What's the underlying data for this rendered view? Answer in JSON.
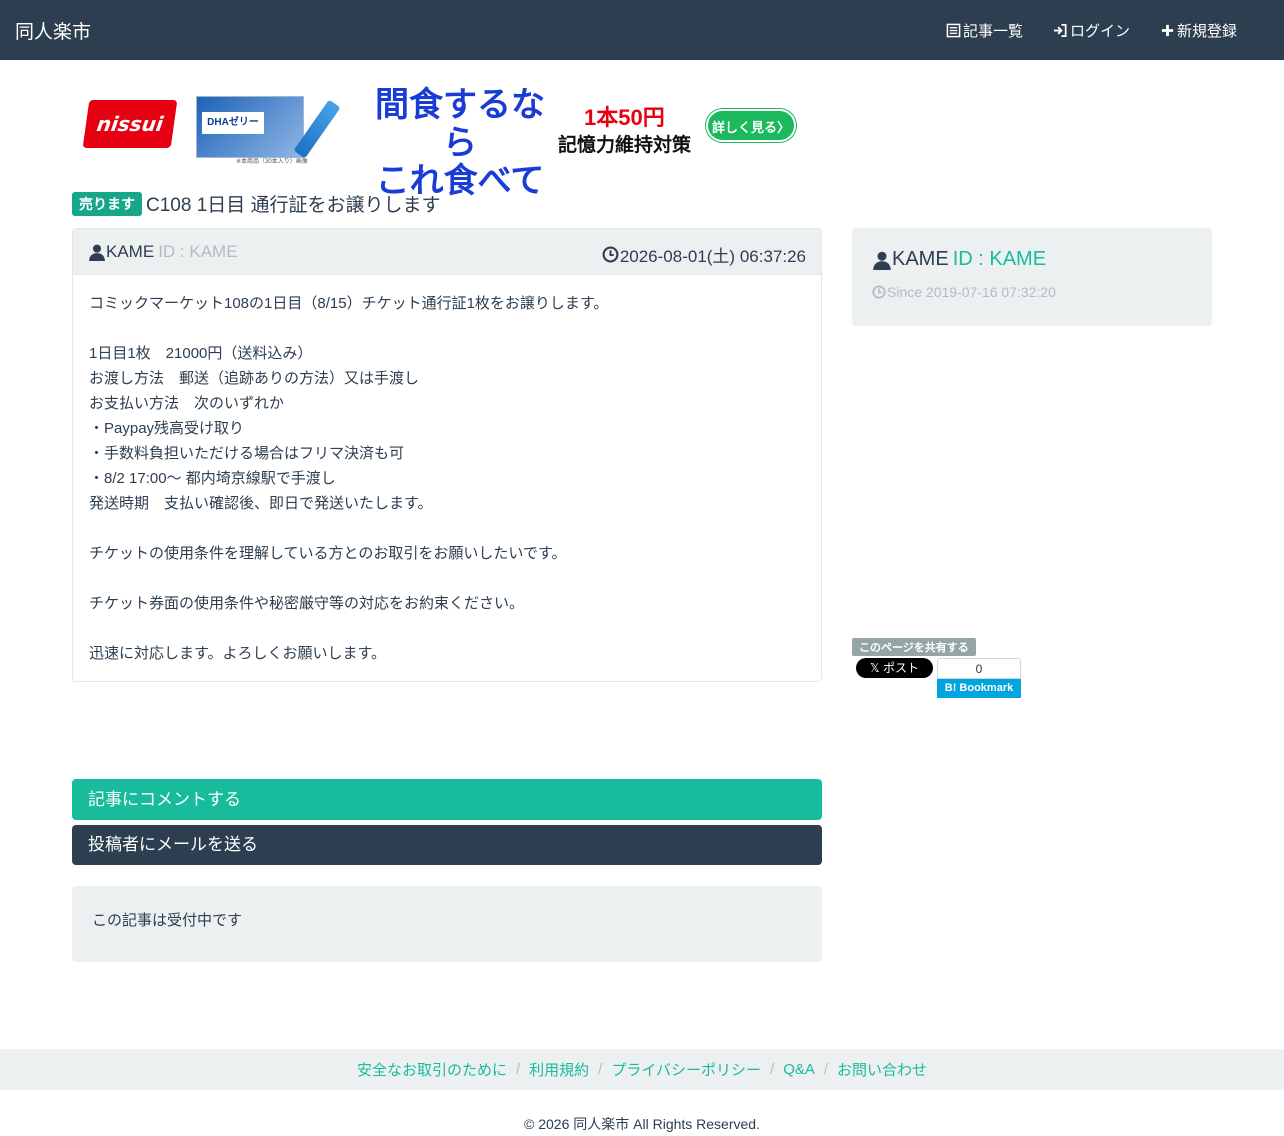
{
  "navbar": {
    "brand": "同人楽市",
    "items": [
      {
        "label": "記事一覧",
        "icon": "list-icon"
      },
      {
        "label": "ログイン",
        "icon": "login-icon"
      },
      {
        "label": "新規登録",
        "icon": "plus-icon"
      }
    ]
  },
  "ad": {
    "logo": "nissui",
    "product_label": "DHAゼリー",
    "small_note": "※本商品（30本入り）画像",
    "headline_line1": "間食するなら",
    "headline_line2": "これ食べて",
    "price": "1本50円",
    "tagline": "記憶力維持対策",
    "button": "詳しく見る〉"
  },
  "post": {
    "badge": "売ります",
    "title": "C108 1日目 通行証をお譲りします",
    "user": "KAME",
    "id_label": "ID : KAME",
    "date": "2026-08-01(土) 06:37:26",
    "body_lines": [
      "コミックマーケット108の1日目（8/15）チケット通行証1枚をお譲りします。",
      "",
      "1日目1枚　21000円（送料込み）",
      "お渡し方法　郵送（追跡ありの方法）又は手渡し",
      "お支払い方法　次のいずれか",
      "・Paypay残高受け取り",
      "・手数料負担いただける場合はフリマ決済も可",
      "・8/2 17:00～ 都内埼京線駅で手渡し",
      "発送時期　支払い確認後、即日で発送いたします。",
      "",
      "チケットの使用条件を理解している方とのお取引をお願いしたいです。",
      "",
      "チケット券面の使用条件や秘密厳守等の対応をお約束ください。",
      "",
      "迅速に対応します。よろしくお願いします。"
    ]
  },
  "sidebar": {
    "user": "KAME",
    "id_label": "ID : KAME",
    "since": "Since 2019-07-16 07:32:20",
    "share_label": "このページを共有する",
    "x_button": "𝕏 ポスト",
    "hatena_count": "0",
    "hatena_button": "B! Bookmark"
  },
  "actions": {
    "comment": "記事にコメントする",
    "mail": "投稿者にメールを送る"
  },
  "status": "この記事は受付中です",
  "footer": {
    "links": [
      "安全なお取引のために",
      "利用規約",
      "プライバシーポリシー",
      "Q&A",
      "お問い合わせ"
    ],
    "copyright": "© 2026 同人楽市 All Rights Reserved."
  },
  "colors": {
    "navbar": "#2c3e50",
    "accent": "#18bc9c",
    "badge": "#18a689",
    "well": "#ecf0f1"
  }
}
